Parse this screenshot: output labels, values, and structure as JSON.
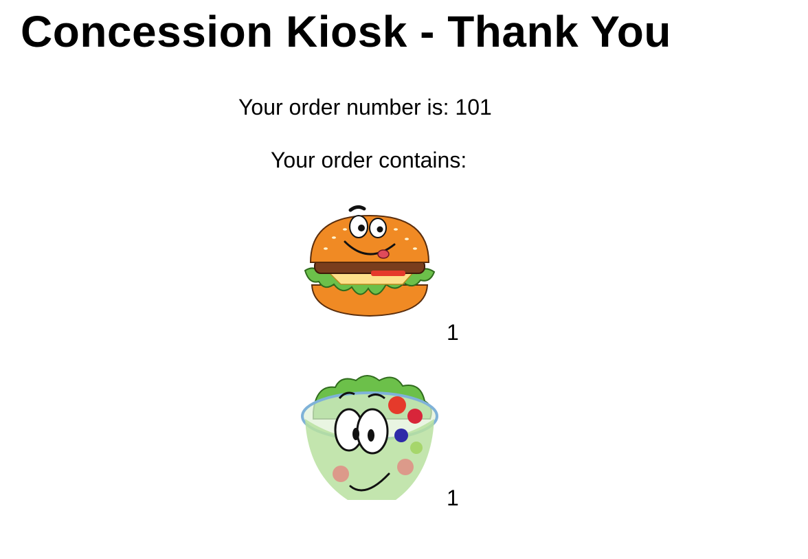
{
  "page": {
    "title": "Concession Kiosk - Thank You"
  },
  "order": {
    "number_text": "Your order number is: 101",
    "contains_label": "Your order contains:",
    "items": [
      {
        "image_icon": "burger-mascot-icon",
        "quantity": "1"
      },
      {
        "image_icon": "salad-bowl-mascot-icon",
        "quantity": "1"
      }
    ]
  },
  "colors": {
    "background": "#ffffff",
    "text": "#000000",
    "bun": "#f08a24",
    "lettuce": "#6cc04a",
    "bowl": "#7fb2d8"
  }
}
